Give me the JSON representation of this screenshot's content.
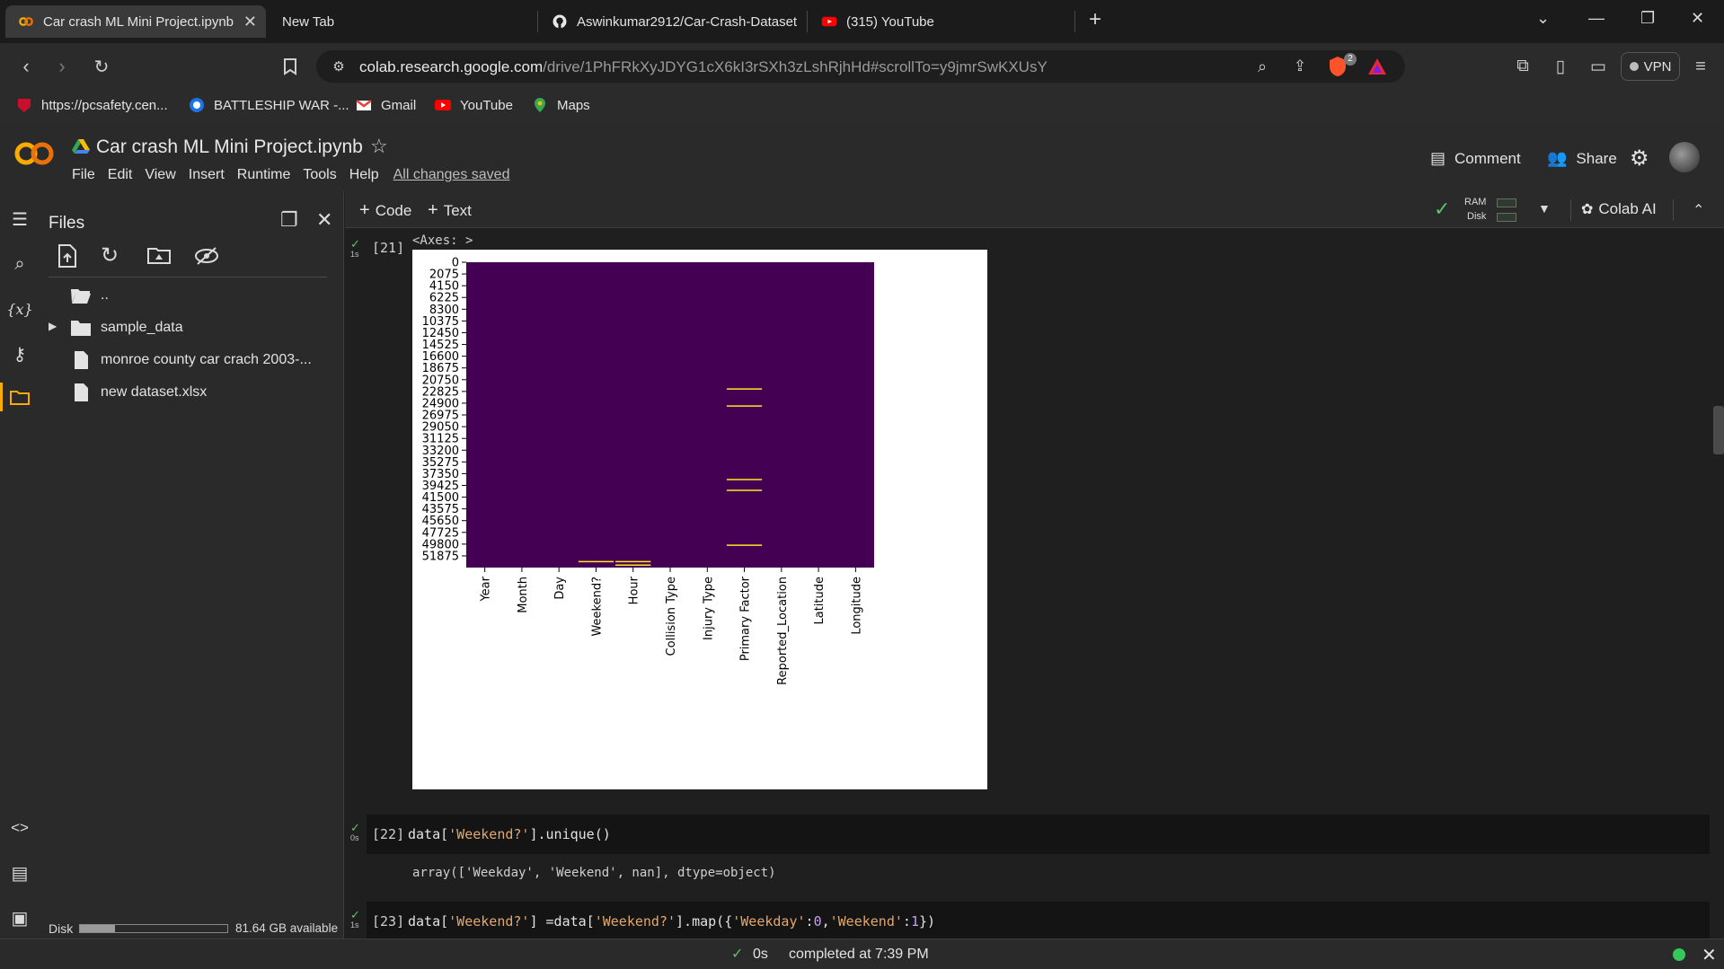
{
  "browser": {
    "tabs": [
      {
        "label": "Car crash ML Mini Project.ipynb",
        "icon": "colab-icon",
        "active": true
      },
      {
        "label": "New Tab",
        "icon": "",
        "active": false
      },
      {
        "label": "Aswinkumar2912/Car-Crash-Dataset",
        "icon": "github-icon",
        "active": false
      },
      {
        "label": "(315) YouTube",
        "icon": "youtube-icon",
        "active": false
      }
    ],
    "url_host": "colab.research.google.com",
    "url_path": "/drive/1PhFRkXyJDYG1cX6kI3rSXh3zLshRjhHd#scrollTo=y9jmrSwKXUsY",
    "brave_badge": "2",
    "vpn_label": "VPN"
  },
  "bookmarks": [
    {
      "label": "https://pcsafety.cen...",
      "icon": "shield-icon"
    },
    {
      "label": "BATTLESHIP WAR -...",
      "icon": "game-icon"
    },
    {
      "label": "Gmail",
      "icon": "gmail-icon"
    },
    {
      "label": "YouTube",
      "icon": "youtube-icon"
    },
    {
      "label": "Maps",
      "icon": "maps-icon"
    }
  ],
  "colab": {
    "title": "Car crash ML Mini Project.ipynb",
    "menu": [
      "File",
      "Edit",
      "View",
      "Insert",
      "Runtime",
      "Tools",
      "Help"
    ],
    "saved_status": "All changes saved",
    "comment_label": "Comment",
    "share_label": "Share",
    "add_code_label": "Code",
    "add_text_label": "Text",
    "ram_label": "RAM",
    "disk_label": "Disk",
    "colab_ai_label": "Colab AI"
  },
  "files_panel": {
    "title": "Files",
    "items": [
      {
        "label": "..",
        "type": "folder-open"
      },
      {
        "label": "sample_data",
        "type": "folder"
      },
      {
        "label": "monroe county car crach 2003-...",
        "type": "file"
      },
      {
        "label": "new dataset.xlsx",
        "type": "file"
      }
    ],
    "disk_label": "Disk",
    "disk_available": "81.64 GB available",
    "disk_used_fraction": 0.24
  },
  "cells": [
    {
      "exec": "[21]",
      "time": "1s",
      "output_label": "<Axes: >"
    },
    {
      "exec": "[22]",
      "time": "0s",
      "code_parts": [
        {
          "t": "data[",
          "c": ""
        },
        {
          "t": "'Weekend?'",
          "c": "s"
        },
        {
          "t": "].unique()",
          "c": ""
        }
      ],
      "output": "array(['Weekday', 'Weekend', nan], dtype=object)"
    },
    {
      "exec": "[23]",
      "time": "1s",
      "code_parts": [
        {
          "t": "data[",
          "c": ""
        },
        {
          "t": "'Weekend?'",
          "c": "s"
        },
        {
          "t": "] =data[",
          "c": ""
        },
        {
          "t": "'Weekend?'",
          "c": "s"
        },
        {
          "t": "].map({",
          "c": ""
        },
        {
          "t": "'Weekday'",
          "c": "s"
        },
        {
          "t": ":",
          "c": ""
        },
        {
          "t": "0",
          "c": "n"
        },
        {
          "t": ",",
          "c": ""
        },
        {
          "t": "'Weekend'",
          "c": "s"
        },
        {
          "t": ":",
          "c": ""
        },
        {
          "t": "1",
          "c": "n"
        },
        {
          "t": "})",
          "c": ""
        }
      ]
    }
  ],
  "chart_data": {
    "type": "heatmap",
    "title": "",
    "categories": [
      "Year",
      "Month",
      "Day",
      "Weekend?",
      "Hour",
      "Collision Type",
      "Injury Type",
      "Primary Factor",
      "Reported_Location",
      "Latitude",
      "Longitude"
    ],
    "yticks": [
      "0",
      "2075",
      "4150",
      "6225",
      "8300",
      "10375",
      "12450",
      "14525",
      "16600",
      "18675",
      "20750",
      "22825",
      "24900",
      "26975",
      "29050",
      "31125",
      "33200",
      "35275",
      "37350",
      "39425",
      "41500",
      "43575",
      "45650",
      "47725",
      "49800",
      "51875"
    ],
    "ylim": [
      0,
      53943
    ],
    "background_color": "#440154",
    "highlight_color": "#fde725",
    "missing_markers": [
      {
        "column": "Weekend?",
        "row": 52900
      },
      {
        "column": "Hour",
        "row": 52900
      },
      {
        "column": "Hour",
        "row": 53500
      },
      {
        "column": "Primary Factor",
        "row": 22400
      },
      {
        "column": "Primary Factor",
        "row": 25400
      },
      {
        "column": "Primary Factor",
        "row": 38400
      },
      {
        "column": "Primary Factor",
        "row": 40300
      },
      {
        "column": "Primary Factor",
        "row": 50000
      }
    ]
  },
  "status": {
    "elapsed": "0s",
    "completed": "completed at 7:39 PM"
  }
}
